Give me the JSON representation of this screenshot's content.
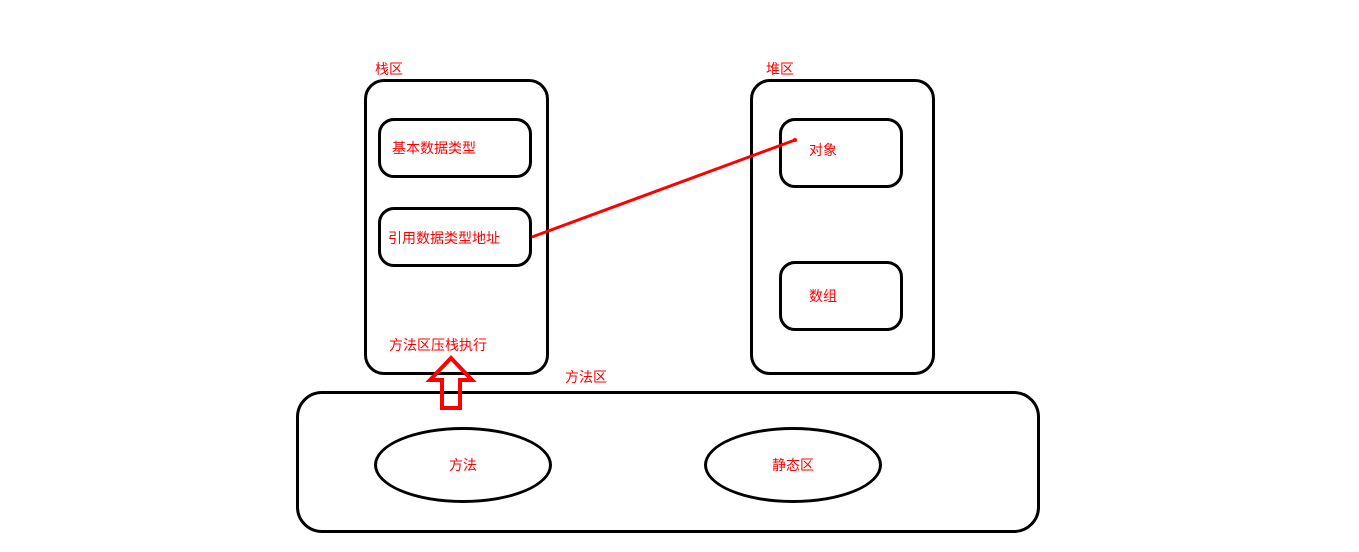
{
  "labels": {
    "stack_title": "栈区",
    "heap_title": "堆区",
    "method_area_title": "方法区",
    "basic_type": "基本数据类型",
    "ref_type_addr": "引用数据类型地址",
    "stack_exec": "方法区压栈执行",
    "object": "对象",
    "array": "数组",
    "method": "方法",
    "static_area": "静态区"
  },
  "colors": {
    "text_red": "#ff0000",
    "stroke_black": "#000000",
    "arrow_red": "#ff0000"
  }
}
